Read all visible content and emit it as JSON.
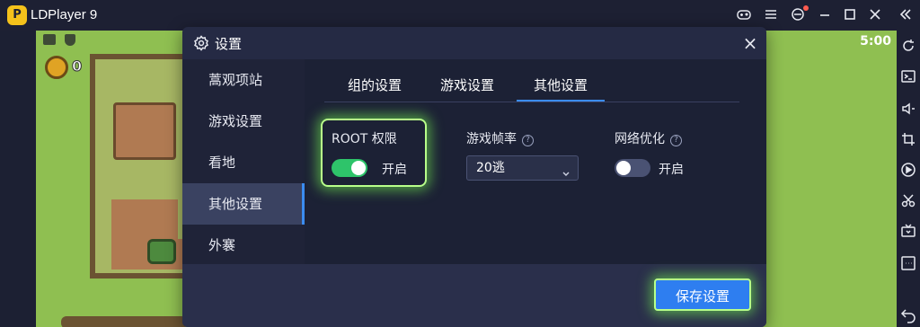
{
  "app": {
    "title": "LDPlayer 9",
    "logo_letter": "P"
  },
  "titlebar": {
    "icons": [
      "gamepad-icon",
      "menu-icon",
      "settings-notify-icon",
      "minimize-icon",
      "maximize-icon",
      "close-icon",
      "collapse-icon"
    ]
  },
  "game": {
    "coin_count": "0",
    "timer": "5:00"
  },
  "rightbar": {
    "icons": [
      "rotate-icon",
      "keyboard-icon",
      "volume-icon",
      "crop-icon",
      "record-icon",
      "scissors-icon",
      "tv-icon",
      "more-icon",
      "back-icon"
    ]
  },
  "dialog": {
    "title": "设置",
    "close_label": "×",
    "sidebar": [
      {
        "label": "蒿观项站"
      },
      {
        "label": "游戏设置"
      },
      {
        "label": "看地"
      },
      {
        "label": "其他设置",
        "active": true
      },
      {
        "label": "外褰"
      }
    ],
    "tabs": [
      {
        "label": "组的设置"
      },
      {
        "label": "游戏设置"
      },
      {
        "label": "其他设置",
        "active": true
      }
    ],
    "root": {
      "label": "ROOT 权限",
      "state": "开启",
      "enabled": true
    },
    "framerate": {
      "label": "游戏帧率",
      "value": "20逃"
    },
    "network": {
      "label": "网络优化",
      "state": "开启",
      "enabled": false
    },
    "save_label": "保存设置"
  },
  "colors": {
    "accent": "#3b8cf0",
    "toggle_on": "#2ec46a",
    "highlight_glow": "#b8ff8a"
  }
}
